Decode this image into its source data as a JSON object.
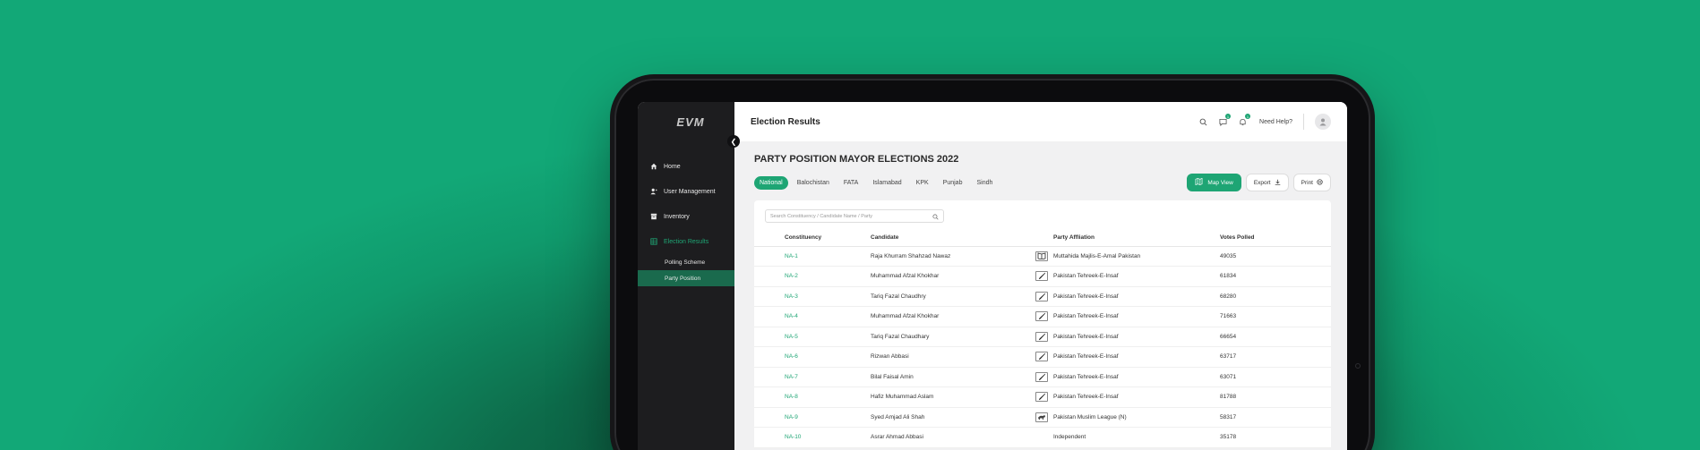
{
  "app": {
    "logo": "EVM",
    "page_header": "Election Results"
  },
  "sidebar": {
    "items": [
      {
        "label": "Home",
        "icon": "home-icon"
      },
      {
        "label": "User Management",
        "icon": "user-management-icon"
      },
      {
        "label": "Inventory",
        "icon": "inventory-icon"
      },
      {
        "label": "Election Results",
        "icon": "election-results-icon"
      }
    ],
    "sub_items": [
      {
        "label": "Polling Scheme"
      },
      {
        "label": "Party Position"
      }
    ]
  },
  "topbar": {
    "help_label": "Need Help?",
    "messages_count": "1",
    "notifications_count": "1"
  },
  "main": {
    "title": "PARTY POSITION MAYOR ELECTIONS 2022",
    "tabs": [
      "National",
      "Balochistan",
      "FATA",
      "Islamabad",
      "KPK",
      "Punjab",
      "Sindh"
    ],
    "map_view_label": "Map View",
    "export_label": "Export",
    "print_label": "Print",
    "search_placeholder": "Search Constituency / Candidate Name / Party"
  },
  "table": {
    "headers": {
      "constituency": "Constituency",
      "candidate": "Candidate",
      "party": "Party Affliation",
      "votes": "Votes Polled"
    },
    "rows": [
      {
        "constituency": "NA-1",
        "candidate": "Raja Khurram Shahzad Nawaz",
        "party": "Muttahida Majlis-E-Amal Pakistan",
        "votes": "49035",
        "symbol": "book-symbol"
      },
      {
        "constituency": "NA-2",
        "candidate": "Muhammad Afzal Khokhar",
        "party": "Pakistan Tehreek-E-Insaf",
        "votes": "61834",
        "symbol": "bat-symbol"
      },
      {
        "constituency": "NA-3",
        "candidate": "Tariq Fazal Chaudhry",
        "party": "Pakistan Tehreek-E-Insaf",
        "votes": "68280",
        "symbol": "bat-symbol"
      },
      {
        "constituency": "NA-4",
        "candidate": "Muhammad Afzal Khokhar",
        "party": "Pakistan Tehreek-E-Insaf",
        "votes": "71663",
        "symbol": "bat-symbol"
      },
      {
        "constituency": "NA-5",
        "candidate": "Tariq Fazal Chaudhary",
        "party": "Pakistan Tehreek-E-Insaf",
        "votes": "66654",
        "symbol": "bat-symbol"
      },
      {
        "constituency": "NA-6",
        "candidate": "Rizwan Abbasi",
        "party": "Pakistan Tehreek-E-Insaf",
        "votes": "63717",
        "symbol": "bat-symbol"
      },
      {
        "constituency": "NA-7",
        "candidate": "Bilal Faisal Amin",
        "party": "Pakistan Tehreek-E-Insaf",
        "votes": "63071",
        "symbol": "bat-symbol"
      },
      {
        "constituency": "NA-8",
        "candidate": "Hafiz Muhammad Aslam",
        "party": "Pakistan Tehreek-E-Insaf",
        "votes": "81788",
        "symbol": "bat-symbol"
      },
      {
        "constituency": "NA-9",
        "candidate": "Syed Amjad Ali Shah",
        "party": "Pakistan Muslim League (N)",
        "votes": "58317",
        "symbol": "tiger-symbol"
      },
      {
        "constituency": "NA-10",
        "candidate": "Asrar Ahmad Abbasi",
        "party": "Independent",
        "votes": "35178",
        "symbol": ""
      }
    ]
  },
  "colors": {
    "accent": "#1ea574",
    "sidebar_bg": "#1d1d1f",
    "selected_sub_bg": "#1a6a4d"
  }
}
